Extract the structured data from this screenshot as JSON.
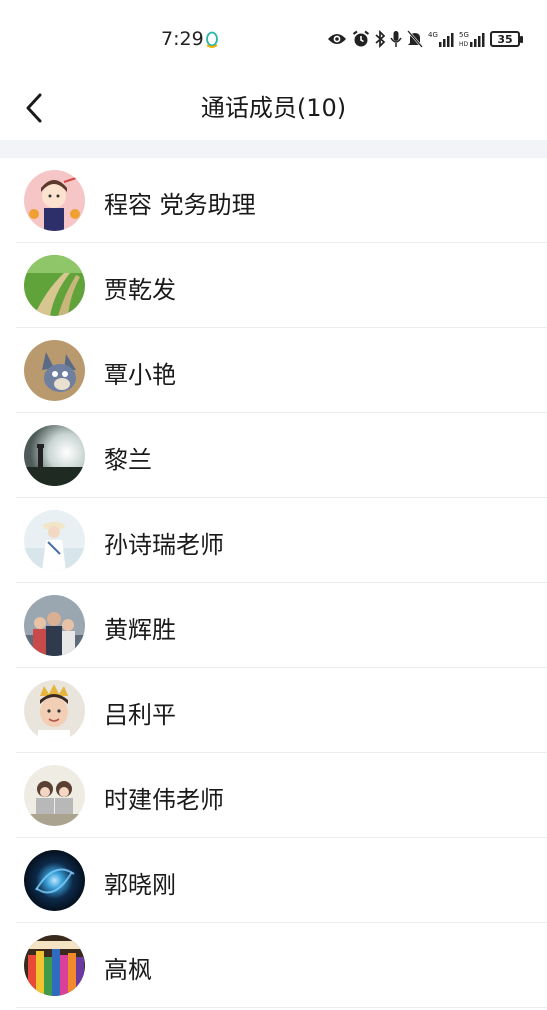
{
  "status_bar": {
    "time": "7:29",
    "battery": "35",
    "icons": [
      "qq-icon",
      "eye-icon",
      "alarm-icon",
      "bluetooth-icon",
      "mic-icon",
      "mute-bell-icon",
      "signal-4g-icon",
      "signal-5g-icon",
      "battery-icon"
    ]
  },
  "nav": {
    "back_icon": "chevron-left-icon",
    "title": "通话成员(10)"
  },
  "members": [
    {
      "name": "程容 党务助理",
      "avatar": "cartoon-kid-avatar"
    },
    {
      "name": "贾乾发",
      "avatar": "grass-path-avatar"
    },
    {
      "name": "覃小艳",
      "avatar": "cartoon-cat-avatar"
    },
    {
      "name": "黎兰",
      "avatar": "lighthouse-avatar"
    },
    {
      "name": "孙诗瑞老师",
      "avatar": "beach-girl-avatar"
    },
    {
      "name": "黄辉胜",
      "avatar": "family-photo-avatar"
    },
    {
      "name": "吕利平",
      "avatar": "crowned-child-avatar"
    },
    {
      "name": "时建伟老师",
      "avatar": "two-kids-avatar"
    },
    {
      "name": "郭晓刚",
      "avatar": "galaxy-avatar"
    },
    {
      "name": "高枫",
      "avatar": "colored-pencils-avatar"
    }
  ],
  "colors": {
    "background": "#ffffff",
    "divider_band": "#f3f4f7",
    "text": "#1a1a1a",
    "row_separator": "#ececec"
  }
}
